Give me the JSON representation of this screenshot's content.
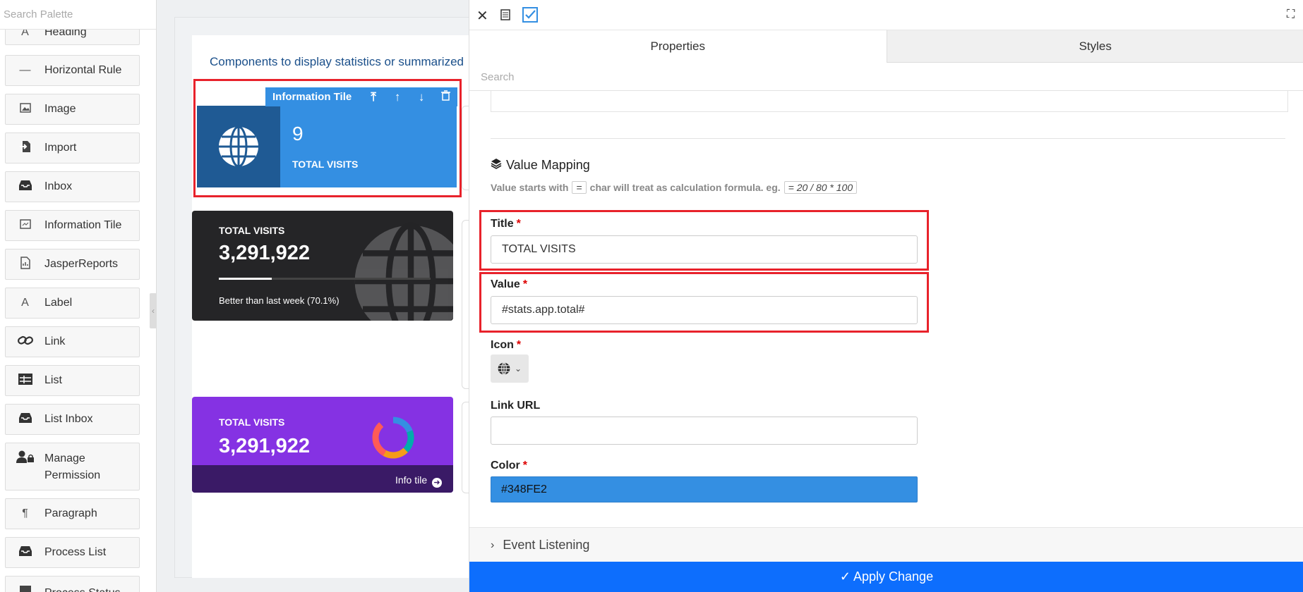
{
  "palette": {
    "search_placeholder": "Search Palette",
    "items": [
      {
        "label": "Heading",
        "icon": "heading-icon"
      },
      {
        "label": "Horizontal Rule",
        "icon": "horizontal-rule-icon"
      },
      {
        "label": "Image",
        "icon": "image-icon"
      },
      {
        "label": "Import",
        "icon": "import-icon"
      },
      {
        "label": "Inbox",
        "icon": "inbox-icon"
      },
      {
        "label": "Information Tile",
        "icon": "information-tile-icon"
      },
      {
        "label": "JasperReports",
        "icon": "report-icon"
      },
      {
        "label": "Label",
        "icon": "label-icon"
      },
      {
        "label": "Link",
        "icon": "link-icon"
      },
      {
        "label": "List",
        "icon": "list-icon"
      },
      {
        "label": "List Inbox",
        "icon": "inbox-icon"
      },
      {
        "label": "Manage Permission",
        "icon": "user-lock-icon"
      },
      {
        "label": "Paragraph",
        "icon": "paragraph-icon"
      },
      {
        "label": "Process List",
        "icon": "inbox-icon"
      },
      {
        "label": "Process Status",
        "icon": "status-icon"
      }
    ]
  },
  "canvas": {
    "title": "Components to display statistics or summarized",
    "selected_tile": {
      "toolbar_label": "Information Tile",
      "value": "9",
      "title": "TOTAL VISITS",
      "color": "#348FE2"
    },
    "tile_dark": {
      "title": "TOTAL VISITS",
      "value": "3,291,922",
      "progress": 0.25,
      "description": "Better than last week (70.1%)"
    },
    "tile_purple": {
      "title": "TOTAL VISITS",
      "value": "3,291,922",
      "footer_link": "Info tile"
    }
  },
  "panel": {
    "tabs": [
      "Properties",
      "Styles"
    ],
    "search_placeholder": "Search",
    "section_title": "Value Mapping",
    "hint": {
      "prefix": "Value starts with",
      "char": "=",
      "middle": "char will treat as calculation formula. eg.",
      "example": "= 20 / 80 * 100"
    },
    "fields": {
      "title_label": "Title",
      "title_value": "TOTAL VISITS",
      "value_label": "Value",
      "value_value": "#stats.app.total#",
      "icon_label": "Icon",
      "link_label": "Link URL",
      "link_value": "",
      "color_label": "Color",
      "color_value": "#348FE2"
    },
    "required_mark": "*",
    "event_listening": "Event Listening",
    "apply_label": "Apply Change"
  },
  "colors": {
    "tile_blue": "#348fe2",
    "tile_dark": "#252527",
    "tile_purple": "#8532e3",
    "highlight": "#e8222b",
    "apply_button": "#0d6efd"
  }
}
